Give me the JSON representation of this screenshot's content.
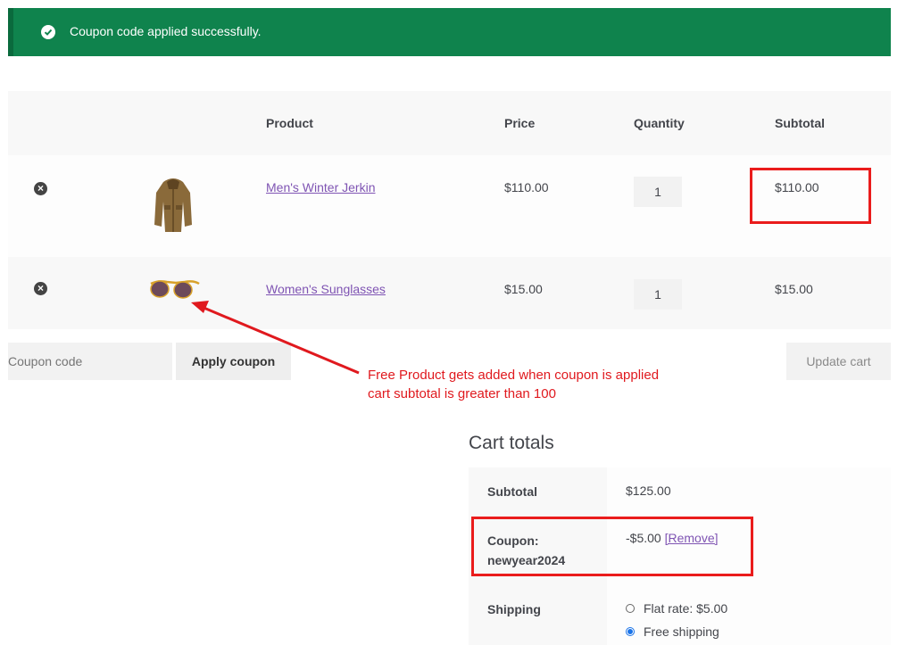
{
  "notice": {
    "message": "Coupon code applied successfully."
  },
  "table": {
    "headers": {
      "product": "Product",
      "price": "Price",
      "quantity": "Quantity",
      "subtotal": "Subtotal"
    },
    "rows": [
      {
        "name": "Men's Winter Jerkin",
        "price": "$110.00",
        "qty": "1",
        "subtotal": "$110.00"
      },
      {
        "name": "Women's Sunglasses",
        "price": "$15.00",
        "qty": "1",
        "subtotal": "$15.00"
      }
    ]
  },
  "actions": {
    "coupon_placeholder": "Coupon code",
    "apply_label": "Apply coupon",
    "update_label": "Update cart"
  },
  "annotation": {
    "line1": "Free Product gets added when coupon is applied",
    "line2": "cart subtotal is greater than 100",
    "color": "#e0191e"
  },
  "totals": {
    "title": "Cart totals",
    "subtotal_label": "Subtotal",
    "subtotal_value": "$125.00",
    "coupon_label_1": "Coupon:",
    "coupon_label_2": "newyear2024",
    "coupon_value": "-$5.00",
    "coupon_remove": "[Remove]",
    "shipping_label": "Shipping",
    "shipping_options": [
      "Flat rate: $5.00",
      "Free shipping"
    ]
  },
  "colors": {
    "notice_bg": "#0f834d",
    "link": "#7f54b3",
    "annotation_red": "#ea1c1c"
  }
}
